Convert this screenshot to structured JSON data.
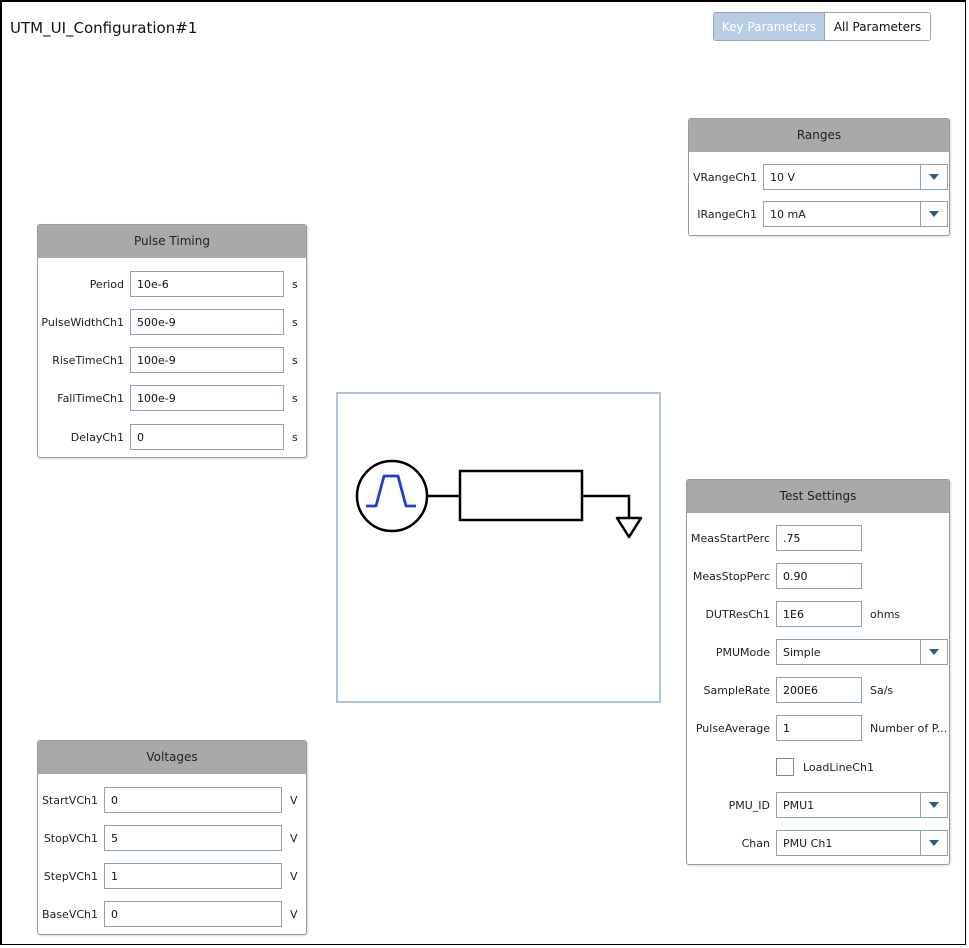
{
  "app": {
    "title": "UTM_UI_Configuration#1"
  },
  "view_toggle": {
    "key_params": "Key Parameters",
    "all_params": "All Parameters",
    "active": "Key Parameters"
  },
  "ranges": {
    "title": "Ranges",
    "vrange_label": "VRangeCh1",
    "vrange_value": "10 V",
    "irange_label": "IRangeCh1",
    "irange_value": "10 mA"
  },
  "pulse_timing": {
    "title": "Pulse Timing",
    "rows": [
      {
        "label": "Period",
        "value": "10e-6",
        "unit": "s"
      },
      {
        "label": "PulseWidthCh1",
        "value": "500e-9",
        "unit": "s"
      },
      {
        "label": "RiseTimeCh1",
        "value": "100e-9",
        "unit": "s"
      },
      {
        "label": "FallTimeCh1",
        "value": "100e-9",
        "unit": "s"
      },
      {
        "label": "DelayCh1",
        "value": "0",
        "unit": "s"
      }
    ]
  },
  "voltages": {
    "title": "Voltages",
    "rows": [
      {
        "label": "StartVCh1",
        "value": "0",
        "unit": "V"
      },
      {
        "label": "StopVCh1",
        "value": "5",
        "unit": "V"
      },
      {
        "label": "StepVCh1",
        "value": "1",
        "unit": "V"
      },
      {
        "label": "BaseVCh1",
        "value": "0",
        "unit": "V"
      }
    ]
  },
  "test_settings": {
    "title": "Test Settings",
    "meas_start_label": "MeasStartPerc",
    "meas_start_value": ".75",
    "meas_stop_label": "MeasStopPerc",
    "meas_stop_value": "0.90",
    "dutres_label": "DUTResCh1",
    "dutres_value": "1E6",
    "dutres_unit": "ohms",
    "pmumode_label": "PMUMode",
    "pmumode_value": "Simple",
    "samplerate_label": "SampleRate",
    "samplerate_value": "200E6",
    "samplerate_unit": "Sa/s",
    "pulseavg_label": "PulseAverage",
    "pulseavg_value": "1",
    "pulseavg_unit": "Number of P...",
    "loadline_label": "LoadLineCh1",
    "loadline_checked": false,
    "pmuid_label": "PMU_ID",
    "pmuid_value": "PMU1",
    "chan_label": "Chan",
    "chan_value": "PMU Ch1"
  },
  "icons": {
    "dropdown": "chevron-down-icon",
    "pulse_source": "pulse-source-icon",
    "resistor": "resistor-icon",
    "ground": "ground-icon"
  },
  "colors": {
    "pulse_wave": "#1e3fd6",
    "header": "#a9a9a9",
    "toggle_active": "#b6cde3"
  }
}
